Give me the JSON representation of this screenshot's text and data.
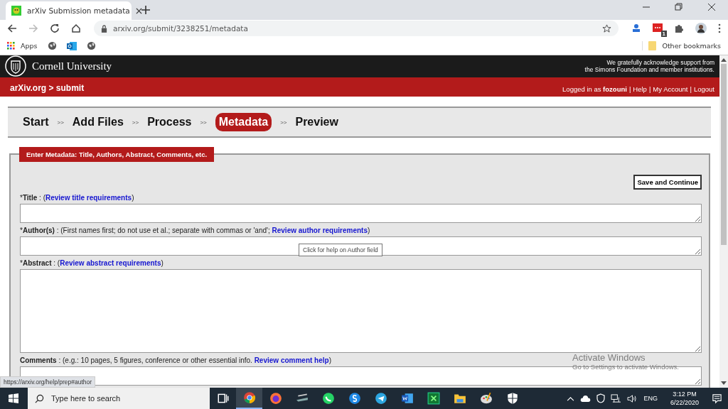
{
  "browser": {
    "tab_title": "arXiv Submission metadata",
    "address": "arxiv.org/submit/3238251/metadata",
    "bookmarks": [
      {
        "kind": "apps",
        "label": "Apps"
      },
      {
        "kind": "globe"
      },
      {
        "kind": "mail"
      },
      {
        "kind": "globe"
      }
    ],
    "other_bookmarks": "Other bookmarks",
    "extension_badge": "1"
  },
  "header": {
    "university": "Cornell University",
    "support_line_1": "We gratefully acknowledge support from",
    "support_line_2": "the Simons Foundation and member institutions.",
    "site": "arXiv.org > submit",
    "logged_in_prefix": "Logged in as ",
    "user": "fozouni",
    "links": [
      "Help",
      "My Account",
      "Logout"
    ],
    "separator": "|"
  },
  "steps": [
    {
      "label": "Start",
      "selected": false
    },
    {
      "label": "Add Files",
      "selected": false
    },
    {
      "label": "Process",
      "selected": false
    },
    {
      "label": "Metadata",
      "selected": true
    },
    {
      "label": "Preview",
      "selected": false
    }
  ],
  "step_separator": ">>",
  "form": {
    "legend": "Enter Metadata: Title, Authors, Abstract, Comments, etc.",
    "save_button": "Save and Continue",
    "fields": [
      {
        "marker": "*",
        "text": "**Title** : (",
        "link": "Review title requirements",
        "close": ")",
        "kind": "short"
      },
      {
        "marker": "*",
        "text": "**Author(s)** : (First names first; do not use et al.; separate with commas or 'and'; ",
        "link": "Review author requirements",
        "close": ")",
        "kind": "short",
        "tooltip": "Click for help on Author field"
      },
      {
        "marker": "*",
        "text": "**Abstract** : (",
        "link": "Review abstract requirements",
        "close": ")",
        "kind": "tall"
      },
      {
        "text": "**Comments** : (e.g.: 10 pages, 5 figures, conference or other essential info. ",
        "link": "Review comment help",
        "close": ")",
        "kind": "short"
      }
    ]
  },
  "status_url": "https://arxiv.org/help/prep#author",
  "activation": {
    "title": "Activate Windows",
    "subtitle": "Go to Settings to activate Windows."
  },
  "taskbar": {
    "search_placeholder": "Type here to search",
    "apps": [
      {
        "kind": "taskview",
        "active": false
      },
      {
        "kind": "chrome",
        "active": true
      },
      {
        "kind": "firefox",
        "active": false
      },
      {
        "kind": "scanner",
        "active": false
      },
      {
        "kind": "whatsapp",
        "active": false
      },
      {
        "kind": "skype",
        "active": false
      },
      {
        "kind": "telegram",
        "active": false
      },
      {
        "kind": "word",
        "active": false
      },
      {
        "kind": "excel",
        "active": false
      },
      {
        "kind": "folder",
        "active": false
      },
      {
        "kind": "paint",
        "active": false
      },
      {
        "kind": "shield",
        "active": false
      }
    ],
    "language": "ENG",
    "time": "3:12 PM",
    "date": "6/22/2020"
  }
}
